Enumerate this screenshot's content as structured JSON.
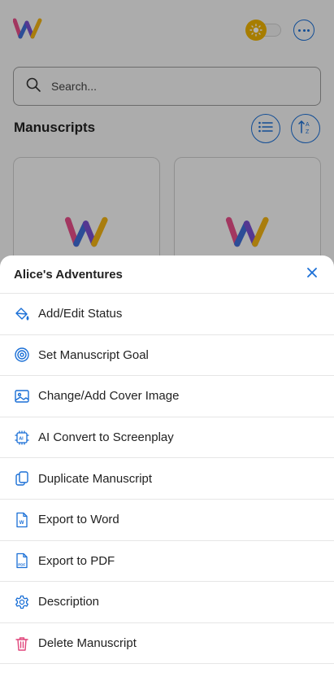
{
  "colors": {
    "accent": "#1a6fd6",
    "danger": "#e0457b",
    "sun": "#f0b400"
  },
  "header": {
    "logo_icon": "writing-app-logo",
    "theme_toggle_icon": "sun-icon",
    "more_icon": "more-horizontal-icon"
  },
  "search": {
    "placeholder": "Search...",
    "value": ""
  },
  "section": {
    "title": "Manuscripts"
  },
  "sheet": {
    "title": "Alice's Adventures",
    "close_icon": "close-icon",
    "items": [
      {
        "label": "Add/Edit Status",
        "icon": "paint-bucket-icon"
      },
      {
        "label": "Set Manuscript Goal",
        "icon": "target-icon"
      },
      {
        "label": "Change/Add Cover Image",
        "icon": "image-icon"
      },
      {
        "label": "AI Convert to Screenplay",
        "icon": "ai-chip-icon"
      },
      {
        "label": "Duplicate Manuscript",
        "icon": "duplicate-icon"
      },
      {
        "label": "Export to Word",
        "icon": "word-file-icon"
      },
      {
        "label": "Export to PDF",
        "icon": "pdf-file-icon"
      },
      {
        "label": "Description",
        "icon": "gear-icon"
      },
      {
        "label": "Delete Manuscript",
        "icon": "trash-icon"
      }
    ]
  }
}
